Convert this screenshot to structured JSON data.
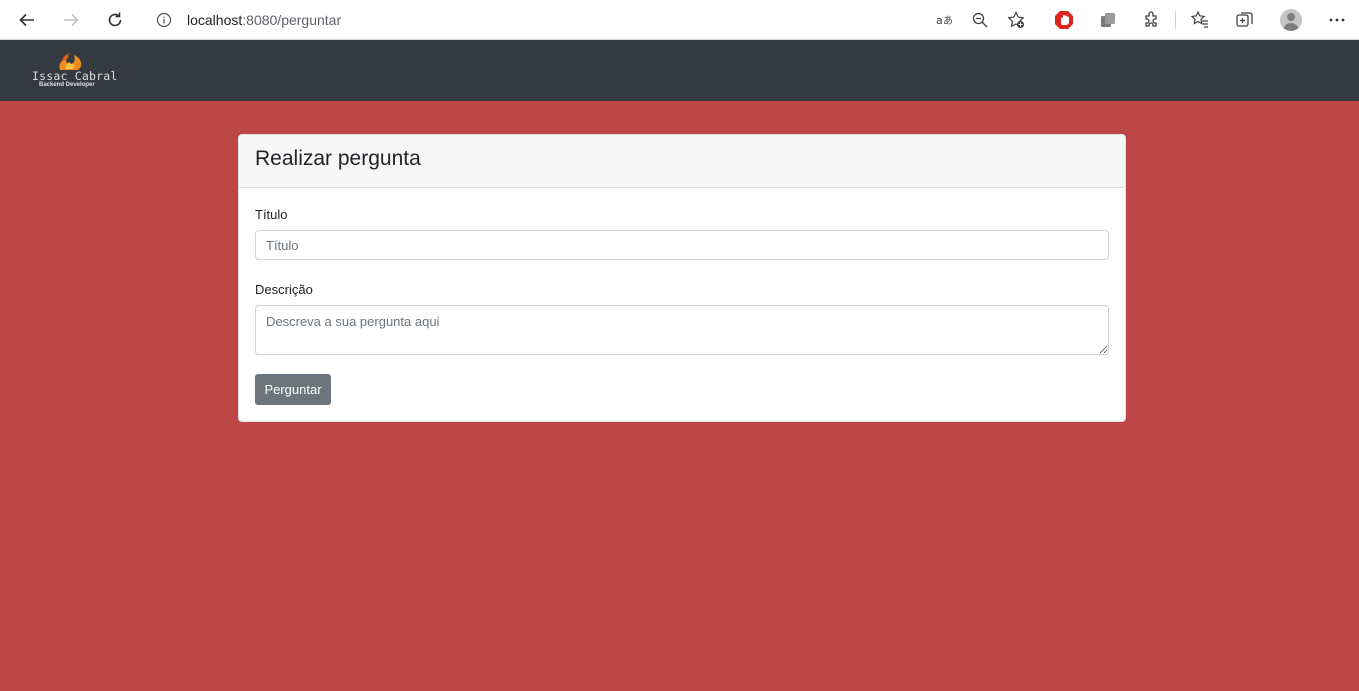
{
  "browser": {
    "url_host": "localhost",
    "url_path": ":8080/perguntar"
  },
  "navbar": {
    "logo_name": "Issac Cabral",
    "logo_subtitle": "Backend Developer"
  },
  "card": {
    "title": "Realizar pergunta",
    "titulo_label": "Título",
    "titulo_placeholder": "Título",
    "descricao_label": "Descrição",
    "descricao_placeholder": "Descreva a sua pergunta aqui",
    "submit_label": "Perguntar"
  },
  "colors": {
    "page_background": "#bd4647",
    "navbar_background": "#343a40",
    "button_background": "#6c757d"
  }
}
